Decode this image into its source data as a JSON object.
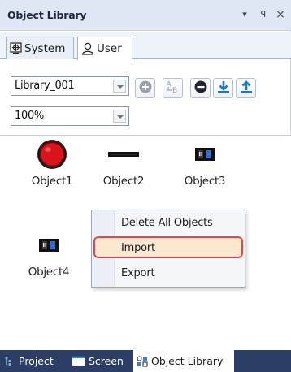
{
  "panel": {
    "title": "Object Library",
    "controls": {
      "dropdown": "▾",
      "pin": "ꟼ",
      "close": "×"
    }
  },
  "tabs": [
    {
      "label": "System",
      "icon": "system-icon"
    },
    {
      "label": "User",
      "icon": "user-icon"
    }
  ],
  "toolbar": {
    "library_select": "Library_001",
    "zoom_select": "100%",
    "buttons": [
      "add-icon",
      "rename-icon",
      "remove-icon",
      "download-icon",
      "upload-icon"
    ]
  },
  "objects": [
    {
      "label": "Object1",
      "icon": "red-lamp-icon"
    },
    {
      "label": "Object2",
      "icon": "bar-icon"
    },
    {
      "label": "Object3",
      "icon": "panel-icon"
    },
    {
      "label": "Object4",
      "icon": "panel-icon"
    }
  ],
  "context_menu": {
    "items": [
      "Delete All Objects",
      "Import",
      "Export"
    ],
    "highlighted": "Import"
  },
  "bottom_tabs": [
    {
      "label": "Project",
      "icon": "project-icon"
    },
    {
      "label": "Screen",
      "icon": "screen-icon"
    },
    {
      "label": "Object Library",
      "icon": "object-library-icon"
    }
  ],
  "colors": {
    "titlebar": "#dfe6f4",
    "bottombar": "#2d3e66",
    "highlight_border": "#e1464a",
    "highlight_fill": "#fde9cf",
    "lamp_red": "#d9141a"
  }
}
